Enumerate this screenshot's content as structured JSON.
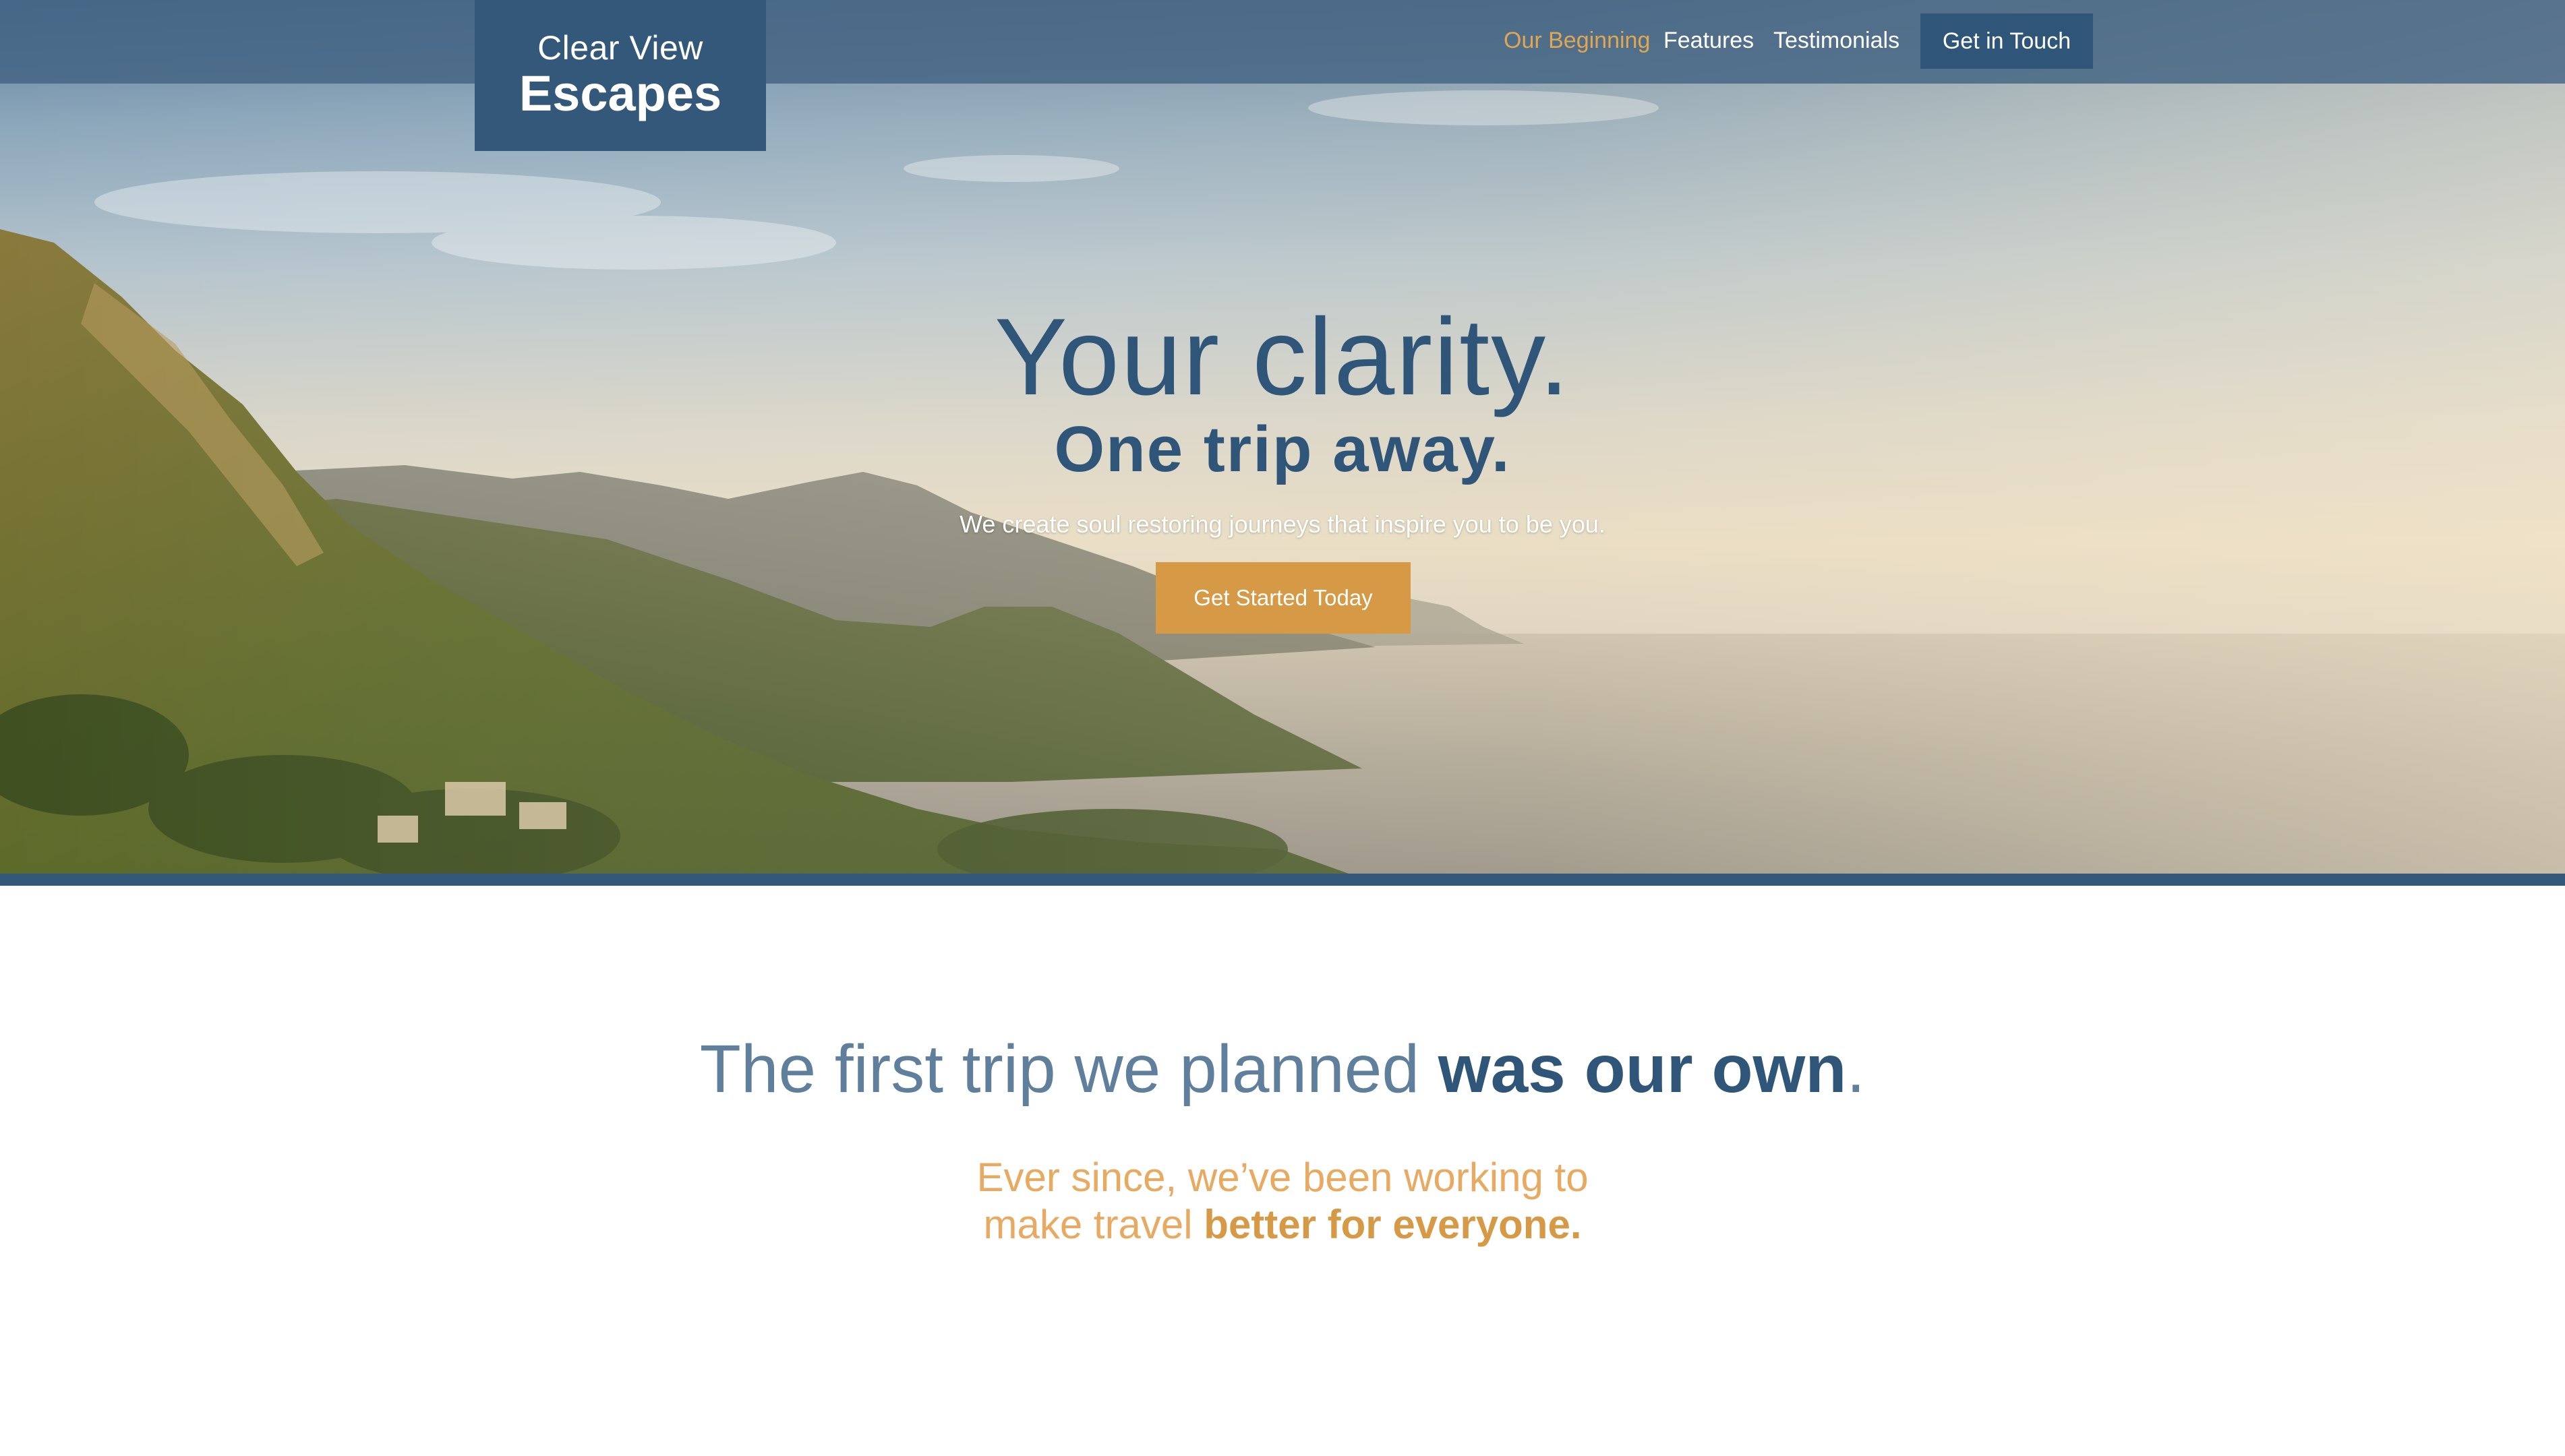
{
  "brand": {
    "line1": "Clear View",
    "line2": "Escapes"
  },
  "nav": {
    "items": [
      {
        "label": "Our Beginning",
        "active": true
      },
      {
        "label": "Features",
        "active": false
      },
      {
        "label": "Testimonials",
        "active": false
      }
    ],
    "cta_label": "Get in Touch"
  },
  "hero": {
    "title": "Your clarity.",
    "subtitle": "One trip away.",
    "tagline": "We create soul restoring journeys that inspire you to be you.",
    "cta_label": "Get Started Today"
  },
  "story": {
    "title_light": "The first trip we planned ",
    "title_bold": "was our own",
    "title_end": ".",
    "sub_line1": "Ever since, we’ve been working to",
    "sub_line2_light": "make travel ",
    "sub_line2_bold": "better for everyone."
  },
  "colors": {
    "primary": "#2f5578",
    "accent": "#d69a47",
    "accent_light": "#e8a960",
    "nav_active": "#e0a652",
    "background": "#ffffff"
  }
}
